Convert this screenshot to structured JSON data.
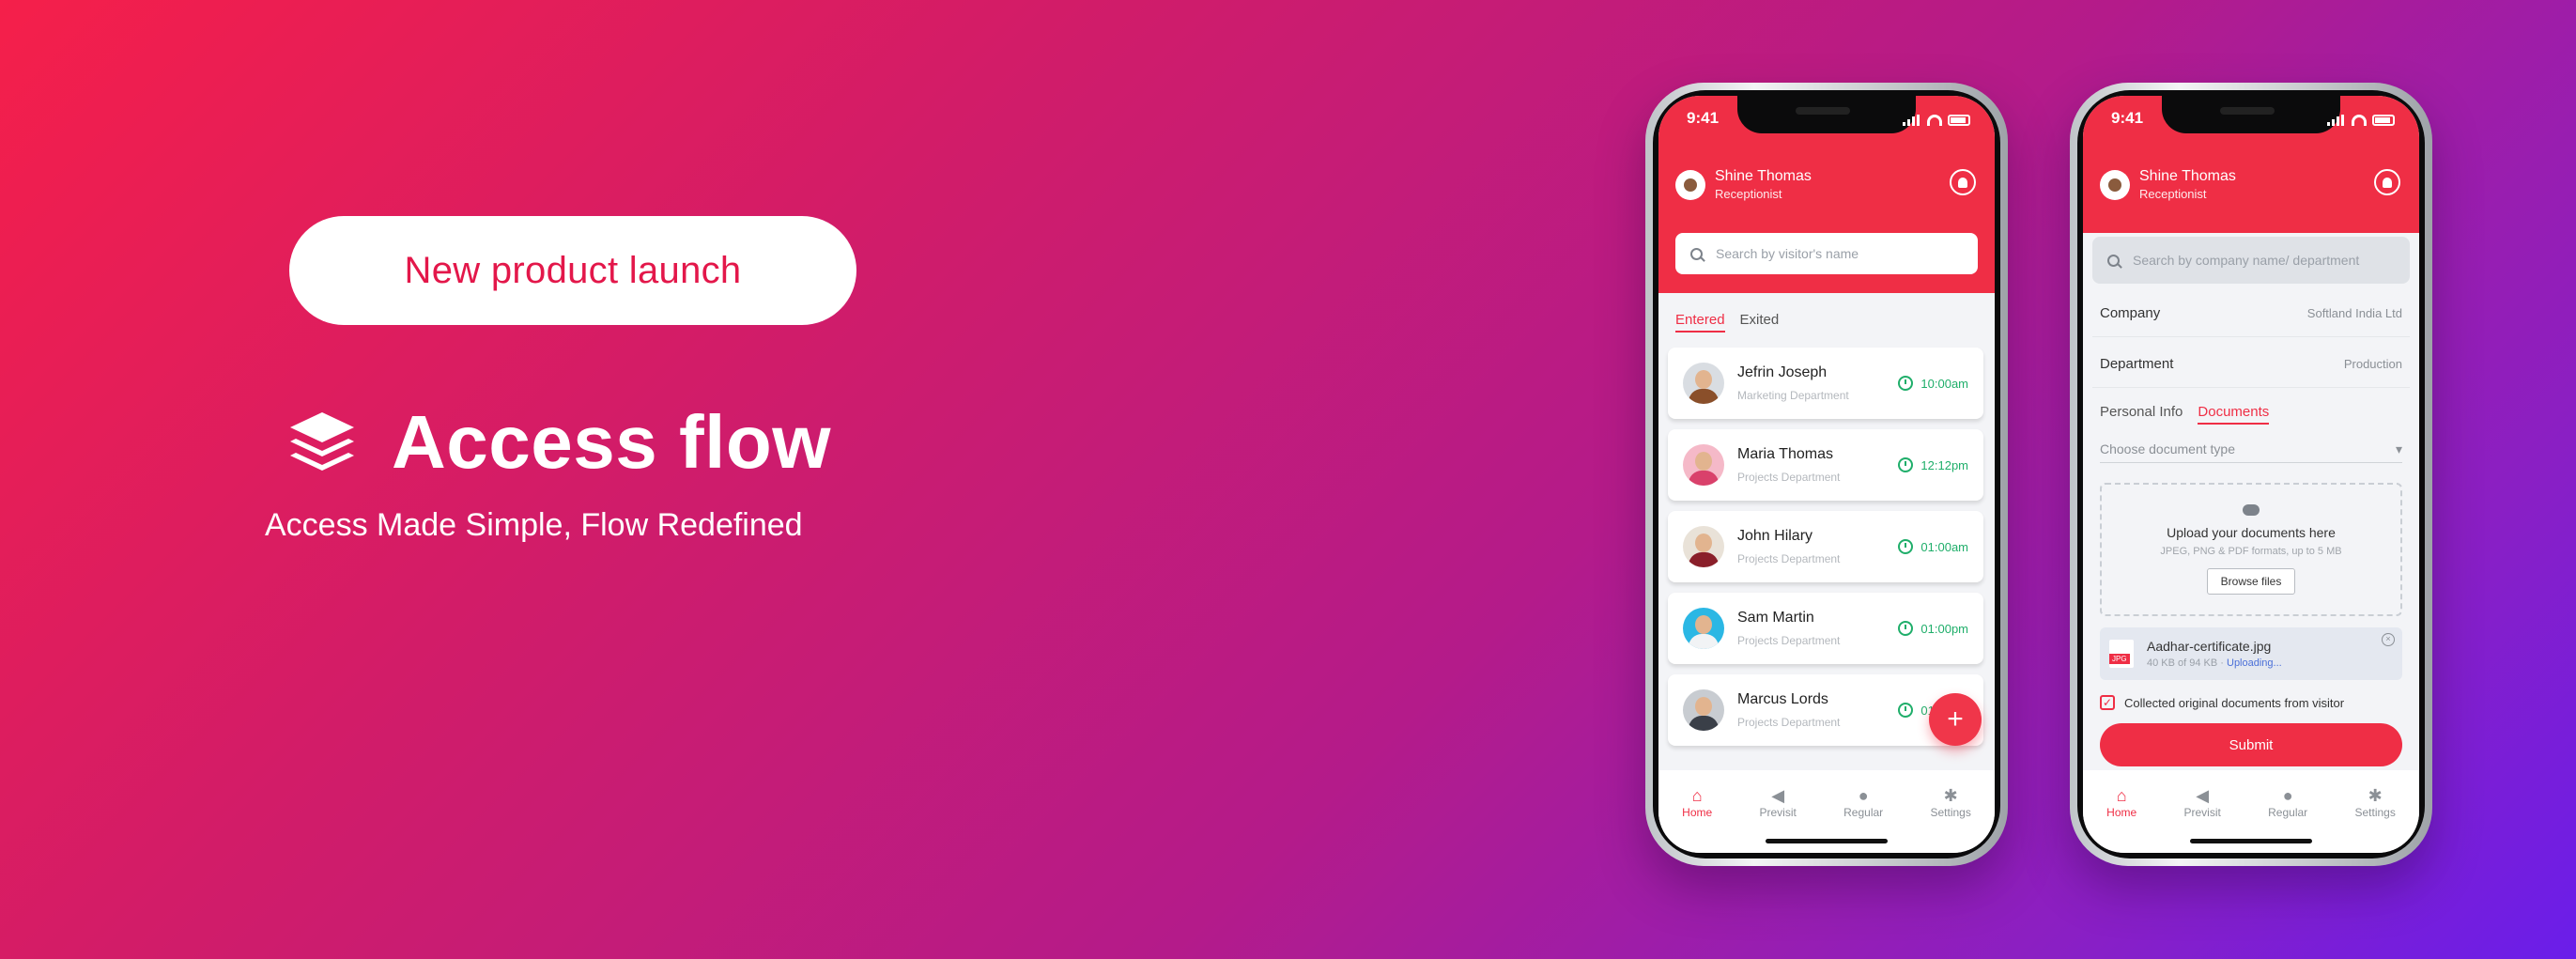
{
  "hero": {
    "badge": "New product launch",
    "brand_name": "Access flow",
    "tagline": "Access Made Simple, Flow Redefined",
    "logo_icon": "layers-icon"
  },
  "colors": {
    "brand": "#ef2e45",
    "success": "#1fae6a"
  },
  "phone1": {
    "time": "9:41",
    "user_name": "Shine Thomas",
    "user_role": "Receptionist",
    "search_placeholder": "Search by visitor's name",
    "tabs": [
      "Entered",
      "Exited"
    ],
    "visitors": [
      {
        "name": "Jefrin Joseph",
        "dept": "Marketing Department",
        "time": "10:00am"
      },
      {
        "name": "Maria Thomas",
        "dept": "Projects Department",
        "time": "12:12pm"
      },
      {
        "name": "John Hilary",
        "dept": "Projects Department",
        "time": "01:00am"
      },
      {
        "name": "Sam Martin",
        "dept": "Projects Department",
        "time": "01:00pm"
      },
      {
        "name": "Marcus Lords",
        "dept": "Projects Department",
        "time": "01:00pm"
      }
    ],
    "fab": "+",
    "nav": [
      "Home",
      "Previsit",
      "Regular",
      "Settings"
    ]
  },
  "phone2": {
    "time": "9:41",
    "user_name": "Shine Thomas",
    "user_role": "Receptionist",
    "search_placeholder": "Search by company name/ department",
    "company_label": "Company",
    "company_value": "Softland India Ltd",
    "department_label": "Department",
    "department_value": "Production",
    "tabs": [
      "Personal Info",
      "Documents"
    ],
    "doc_type_placeholder": "Choose document type",
    "upload_title": "Upload your documents here",
    "upload_hint": "JPEG, PNG & PDF formats, up to 5 MB",
    "browse_label": "Browse files",
    "file_name": "Aadhar-certificate.jpg",
    "file_size": "40 KB of 94 KB",
    "file_status": "Uploading...",
    "file_badge": "JPG",
    "checkbox_label": "Collected original documents from visitor",
    "submit_label": "Submit",
    "nav": [
      "Home",
      "Previsit",
      "Regular",
      "Settings"
    ]
  }
}
